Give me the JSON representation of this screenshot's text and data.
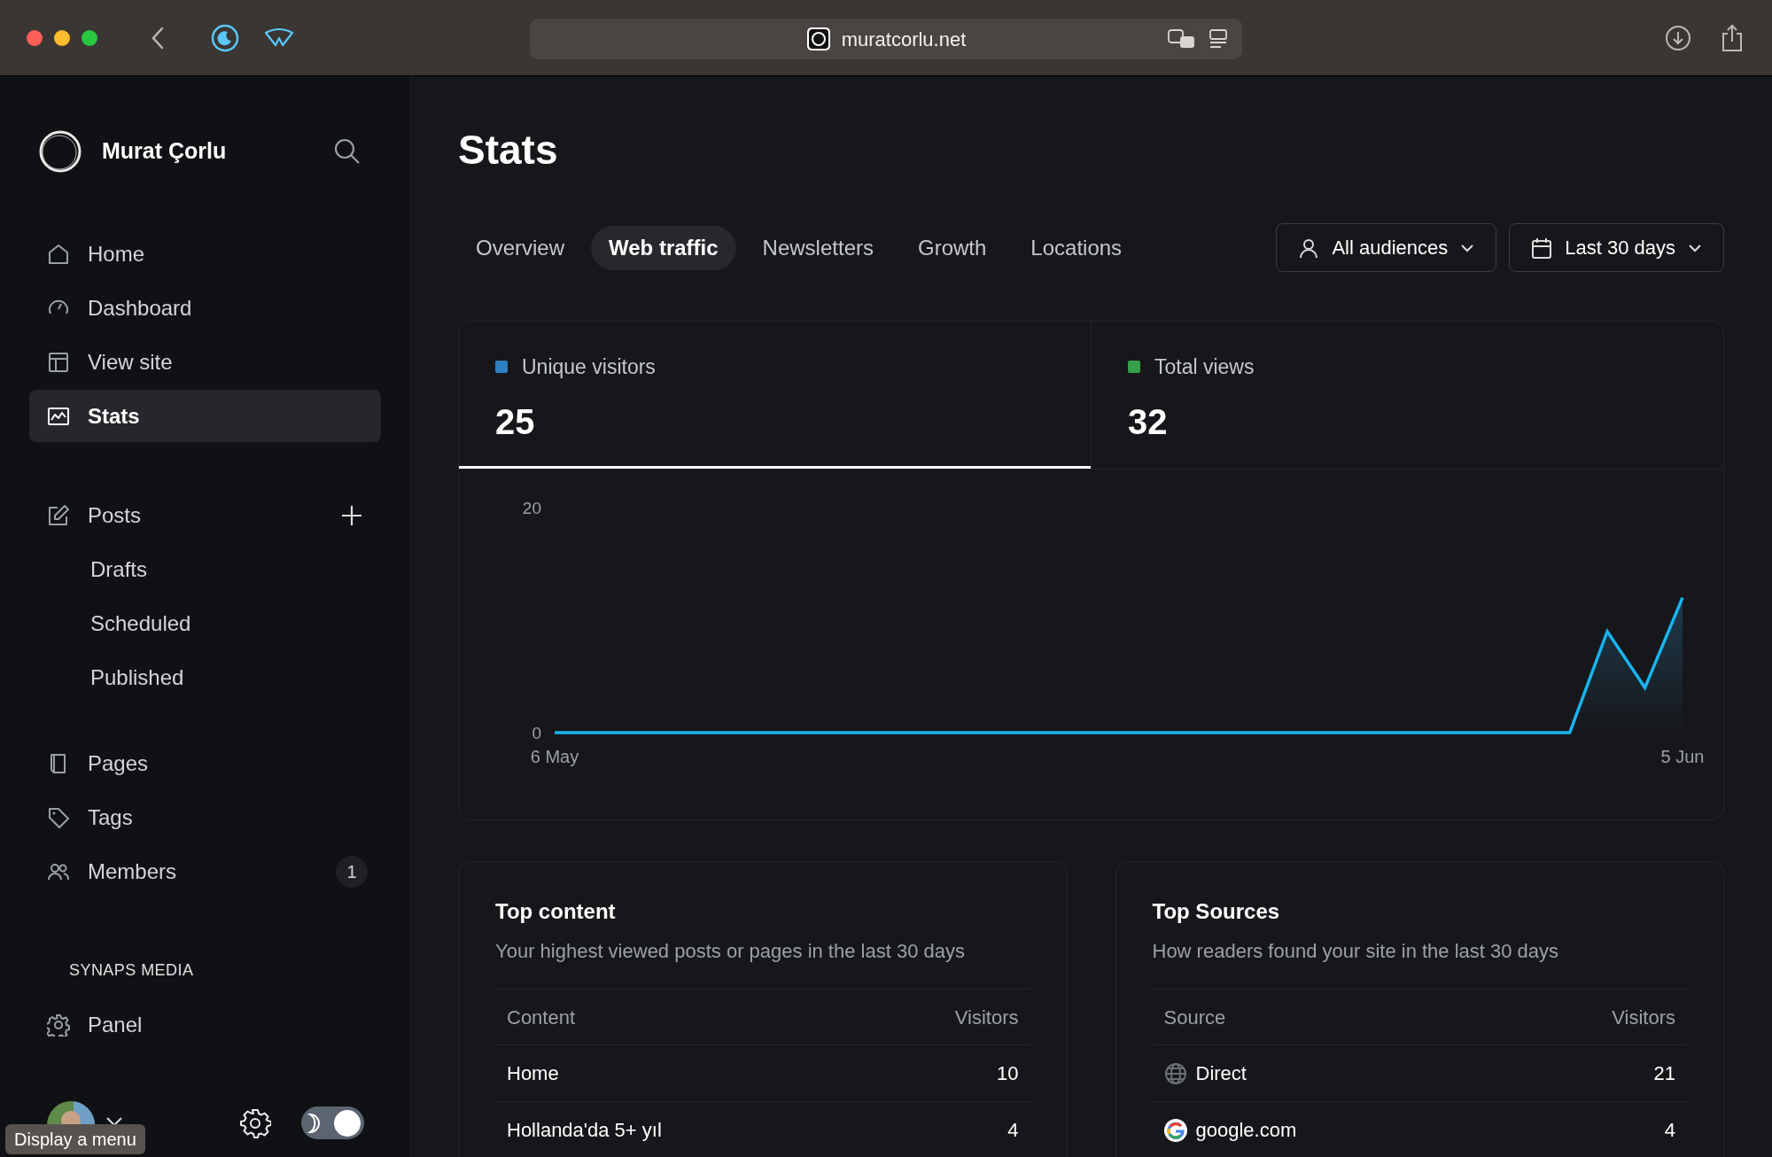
{
  "browser": {
    "url": "muratcorlu.net",
    "tooltip": "Display a menu"
  },
  "sidebar": {
    "site_name": "Murat Çorlu",
    "nav": [
      {
        "label": "Home",
        "selected": false,
        "add_button": false
      },
      {
        "label": "Dashboard",
        "selected": false,
        "add_button": false
      },
      {
        "label": "View site",
        "selected": false,
        "add_button": false
      },
      {
        "label": "Stats",
        "selected": true,
        "add_button": false
      }
    ],
    "posts": [
      {
        "label": "Posts",
        "selected": false,
        "add_button": true,
        "children": [
          {
            "label": "Drafts",
            "selected": false
          },
          {
            "label": "Scheduled",
            "selected": false
          },
          {
            "label": "Published",
            "selected": false
          }
        ]
      }
    ],
    "more": [
      {
        "label": "Pages",
        "selected": false,
        "add_button": false
      },
      {
        "label": "Tags",
        "selected": false,
        "add_button": false
      },
      {
        "label": "Members",
        "selected": false,
        "add_button": false,
        "count": "1"
      }
    ],
    "section_title": "SYNAPS MEDIA",
    "section_items": [
      {
        "label": "Panel",
        "selected": false,
        "add_button": false
      }
    ],
    "dark_mode": true
  },
  "main": {
    "title": "Stats",
    "tabs": [
      {
        "label": "Overview",
        "selected": false
      },
      {
        "label": "Web traffic",
        "selected": true
      },
      {
        "label": "Newsletters",
        "selected": false
      },
      {
        "label": "Growth",
        "selected": false
      },
      {
        "label": "Locations",
        "selected": false
      }
    ],
    "filters": [
      {
        "label": "All audiences"
      },
      {
        "label": "Last 30 days"
      }
    ],
    "metrics": [
      {
        "label": "Unique visitors",
        "value": "25",
        "color": "#2f80c0",
        "selected": true
      },
      {
        "label": "Total views",
        "value": "32",
        "color": "#35a04a",
        "selected": false
      }
    ],
    "chart_data": {
      "type": "area",
      "categories": [
        "6 May",
        null,
        null,
        null,
        null,
        null,
        null,
        null,
        null,
        null,
        null,
        null,
        null,
        null,
        null,
        null,
        null,
        null,
        null,
        null,
        null,
        null,
        null,
        null,
        null,
        null,
        null,
        null,
        null,
        null,
        "5 Jun"
      ],
      "values": [
        0,
        0,
        0,
        0,
        0,
        0,
        0,
        0,
        0,
        0,
        0,
        0,
        0,
        0,
        0,
        0,
        0,
        0,
        0,
        0,
        0,
        0,
        0,
        0,
        0,
        0,
        0,
        0,
        9,
        4,
        12
      ],
      "ylim": [
        0,
        20
      ],
      "yticks": [
        0,
        20
      ]
    },
    "cards": [
      {
        "title": "Top content",
        "subtitle": "Your highest viewed posts or pages in the last 30 days",
        "columns": [
          "Content",
          "Visitors"
        ],
        "rows": [
          {
            "label": "Home",
            "value": "10"
          },
          {
            "label": "Hollanda'da 5+ yıl",
            "value": "4"
          }
        ]
      },
      {
        "title": "Top Sources",
        "subtitle": "How readers found your site in the last 30 days",
        "columns": [
          "Source",
          "Visitors"
        ],
        "rows": [
          {
            "label": "Direct",
            "value": "21"
          },
          {
            "label": "google.com",
            "value": "4"
          }
        ]
      }
    ]
  }
}
